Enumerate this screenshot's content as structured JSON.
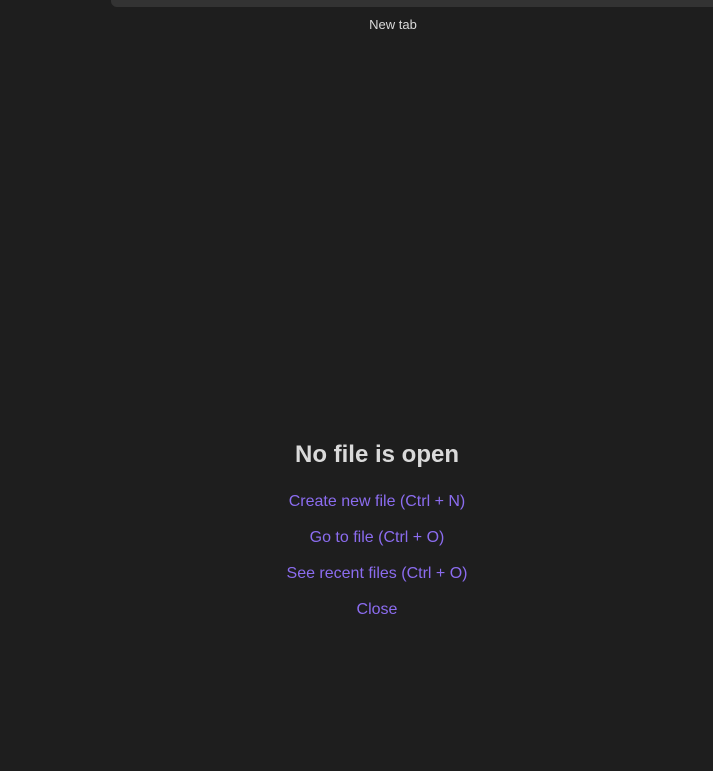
{
  "header": {
    "title": "New tab"
  },
  "empty_state": {
    "title": "No file is open",
    "actions": [
      {
        "label": "Create new file (Ctrl + N)"
      },
      {
        "label": "Go to file (Ctrl + O)"
      },
      {
        "label": "See recent files (Ctrl + O)"
      },
      {
        "label": "Close"
      }
    ]
  },
  "colors": {
    "background": "#1e1e1e",
    "text": "#dadada",
    "accent": "#8b6cef"
  }
}
